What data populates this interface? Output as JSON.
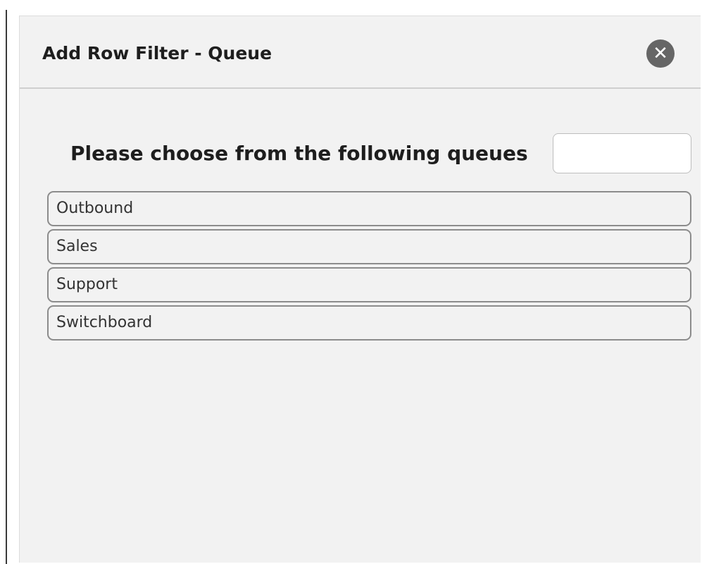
{
  "dialog": {
    "title": "Add Row Filter - Queue",
    "close_icon": "close-icon",
    "prompt": "Please choose from the following queues",
    "filter_input": {
      "value": "",
      "placeholder": ""
    },
    "queues": [
      {
        "label": "Outbound"
      },
      {
        "label": "Sales"
      },
      {
        "label": "Support"
      },
      {
        "label": "Switchboard"
      }
    ]
  },
  "colors": {
    "dialog_background": "#f2f2f2",
    "close_button": "#666666",
    "item_border": "#8c8c8c",
    "title_text": "#1e1e1e"
  }
}
